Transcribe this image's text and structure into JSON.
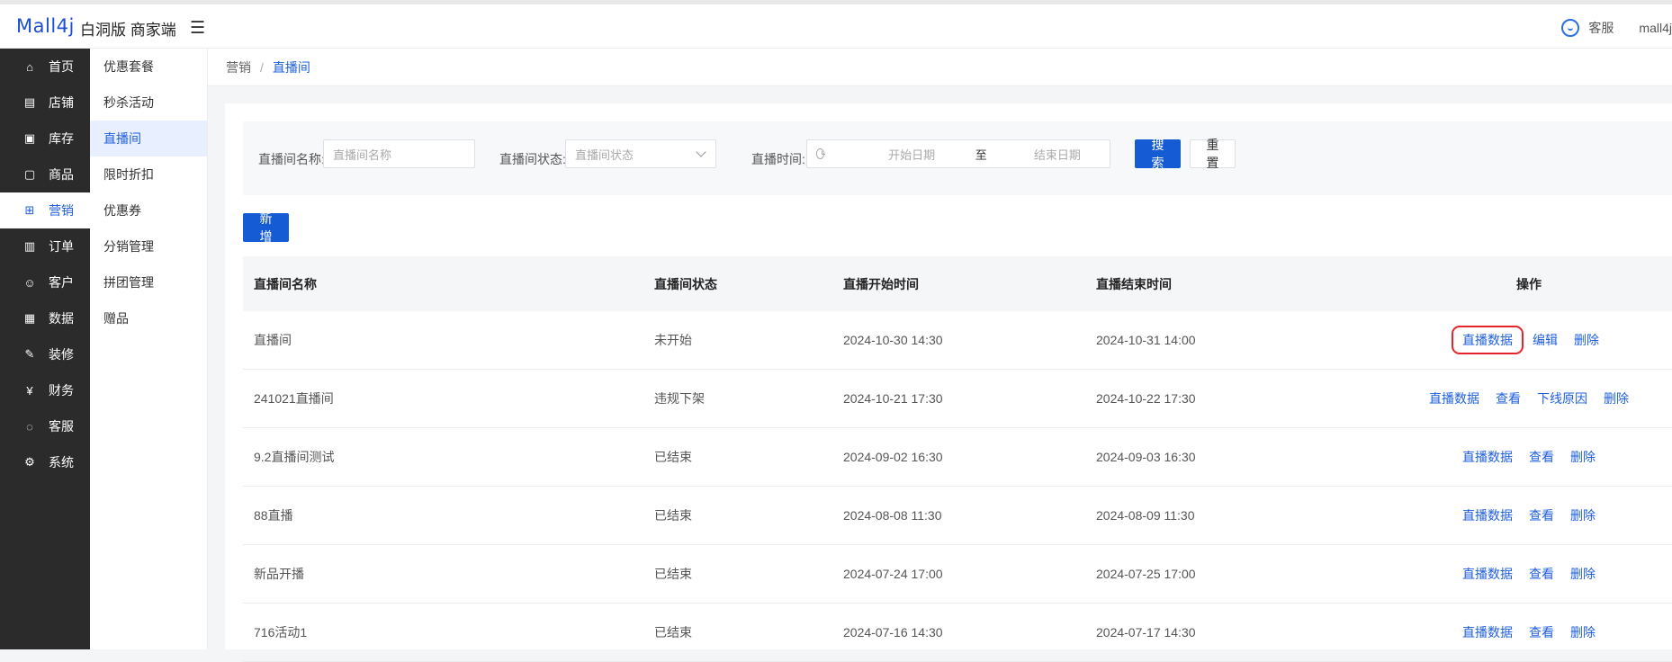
{
  "header": {
    "logo": "Mall4j",
    "title": "白洞版 商家端",
    "service_label": "客服",
    "username": "mall4j"
  },
  "sidebar": {
    "items": [
      {
        "label": "首页",
        "icon": "home-icon",
        "glyph": "⌂"
      },
      {
        "label": "店铺",
        "icon": "shop-icon",
        "glyph": "▤"
      },
      {
        "label": "库存",
        "icon": "inventory-icon",
        "glyph": "▣"
      },
      {
        "label": "商品",
        "icon": "product-icon",
        "glyph": "▢"
      },
      {
        "label": "营销",
        "icon": "gift-icon",
        "glyph": "⊞",
        "active": true
      },
      {
        "label": "订单",
        "icon": "order-icon",
        "glyph": "▥"
      },
      {
        "label": "客户",
        "icon": "customer-icon",
        "glyph": "☺"
      },
      {
        "label": "数据",
        "icon": "data-icon",
        "glyph": "▦"
      },
      {
        "label": "装修",
        "icon": "decorate-icon",
        "glyph": "✎"
      },
      {
        "label": "财务",
        "icon": "finance-icon",
        "glyph": "¥"
      },
      {
        "label": "客服",
        "icon": "chat-icon",
        "glyph": "◌"
      },
      {
        "label": "系统",
        "icon": "settings-icon",
        "glyph": "⚙"
      }
    ]
  },
  "submenu": {
    "items": [
      {
        "label": "优惠套餐"
      },
      {
        "label": "秒杀活动"
      },
      {
        "label": "直播间",
        "active": true
      },
      {
        "label": "限时折扣"
      },
      {
        "label": "优惠券"
      },
      {
        "label": "分销管理"
      },
      {
        "label": "拼团管理"
      },
      {
        "label": "赠品"
      }
    ]
  },
  "breadcrumb": {
    "parent": "营销",
    "current": "直播间"
  },
  "filter": {
    "name_label": "直播间名称:",
    "name_placeholder": "直播间名称",
    "status_label": "直播间状态:",
    "status_placeholder": "直播间状态",
    "time_label": "直播时间:",
    "start_placeholder": "开始日期",
    "range_sep": "至",
    "end_placeholder": "结束日期",
    "search_button": "搜索",
    "reset_button": "重置"
  },
  "add_button": "新增",
  "table": {
    "headers": [
      "直播间名称",
      "直播间状态",
      "直播开始时间",
      "直播结束时间",
      "操作"
    ],
    "rows": [
      {
        "name": "直播间",
        "status": "未开始",
        "start": "2024-10-30 14:30",
        "end": "2024-10-31 14:00",
        "actions": [
          "直播数据",
          "编辑",
          "删除"
        ],
        "highlight": 0
      },
      {
        "name": "241021直播间",
        "status": "违规下架",
        "start": "2024-10-21 17:30",
        "end": "2024-10-22 17:30",
        "actions": [
          "直播数据",
          "查看",
          "下线原因",
          "删除"
        ]
      },
      {
        "name": "9.2直播间测试",
        "status": "已结束",
        "start": "2024-09-02 16:30",
        "end": "2024-09-03 16:30",
        "actions": [
          "直播数据",
          "查看",
          "删除"
        ]
      },
      {
        "name": "88直播",
        "status": "已结束",
        "start": "2024-08-08 11:30",
        "end": "2024-08-09 11:30",
        "actions": [
          "直播数据",
          "查看",
          "删除"
        ]
      },
      {
        "name": "新品开播",
        "status": "已结束",
        "start": "2024-07-24 17:00",
        "end": "2024-07-25 17:00",
        "actions": [
          "直播数据",
          "查看",
          "删除"
        ]
      },
      {
        "name": "716活动1",
        "status": "已结束",
        "start": "2024-07-16 14:30",
        "end": "2024-07-17 14:30",
        "actions": [
          "直播数据",
          "查看",
          "删除"
        ]
      }
    ]
  },
  "colors": {
    "primary": "#155bd4",
    "sidebar_bg": "#2b2b2b",
    "highlight_box": "#e5242b"
  }
}
